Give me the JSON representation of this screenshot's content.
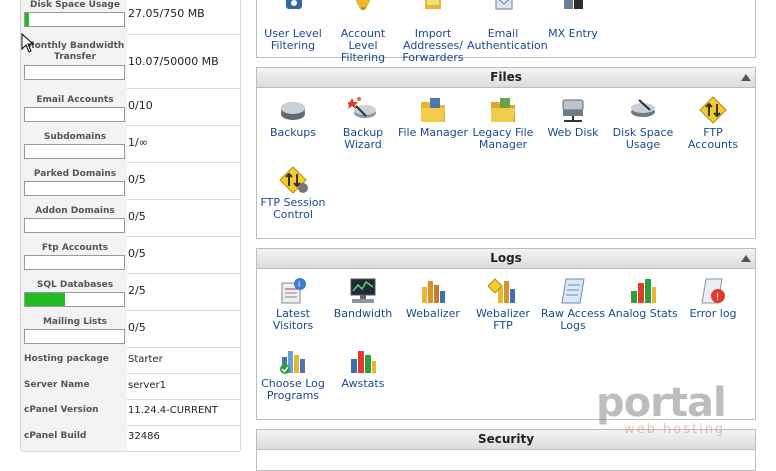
{
  "stats": {
    "disk": {
      "label": "Disk Space Usage",
      "value": "27.05/750 MB",
      "fill": 0.036
    },
    "bandwidth": {
      "label": "Monthly Bandwidth Transfer",
      "value": "10.07/50000 MB",
      "fill": 0.0002
    },
    "email": {
      "label": "Email Accounts",
      "value": "0/10",
      "fill": 0
    },
    "subdomains": {
      "label": "Subdomains",
      "value": "1/∞",
      "fill": 0
    },
    "parked": {
      "label": "Parked Domains",
      "value": "0/5",
      "fill": 0
    },
    "addon": {
      "label": "Addon Domains",
      "value": "0/5",
      "fill": 0
    },
    "ftp": {
      "label": "Ftp Accounts",
      "value": "0/5",
      "fill": 0
    },
    "sql": {
      "label": "SQL Databases",
      "value": "2/5",
      "fill": 0.4
    },
    "mailing": {
      "label": "Mailing Lists",
      "value": "0/5",
      "fill": 0
    },
    "hosting": {
      "label": "Hosting package",
      "value": "Starter"
    },
    "server": {
      "label": "Server Name",
      "value": "server1"
    },
    "cpversion": {
      "label": "cPanel Version",
      "value": "11.24.4-CURRENT"
    },
    "cpbuild": {
      "label": "cPanel Build",
      "value": "32486"
    }
  },
  "mail_panel": {
    "items": [
      {
        "label": "User Level Filtering",
        "icon": "user-filter-icon"
      },
      {
        "label": "Account Level Filtering",
        "icon": "account-filter-icon"
      },
      {
        "label": "Import Addresses/ Forwarders",
        "icon": "import-icon"
      },
      {
        "label": "Email Authentication",
        "icon": "email-auth-icon"
      },
      {
        "label": "MX Entry",
        "icon": "mx-entry-icon"
      }
    ]
  },
  "files": {
    "title": "Files",
    "items": [
      {
        "label": "Backups",
        "icon": "backups-icon"
      },
      {
        "label": "Backup Wizard",
        "icon": "backup-wizard-icon"
      },
      {
        "label": "File Manager",
        "icon": "file-manager-icon"
      },
      {
        "label": "Legacy File Manager",
        "icon": "legacy-file-manager-icon"
      },
      {
        "label": "Web Disk",
        "icon": "web-disk-icon"
      },
      {
        "label": "Disk Space Usage",
        "icon": "disk-usage-icon"
      },
      {
        "label": "FTP Accounts",
        "icon": "ftp-accounts-icon"
      },
      {
        "label": "FTP Session Control",
        "icon": "ftp-session-icon"
      }
    ]
  },
  "logs": {
    "title": "Logs",
    "items": [
      {
        "label": "Latest Visitors",
        "icon": "latest-visitors-icon"
      },
      {
        "label": "Bandwidth",
        "icon": "bandwidth-icon"
      },
      {
        "label": "Webalizer",
        "icon": "webalizer-icon"
      },
      {
        "label": "Webalizer FTP",
        "icon": "webalizer-ftp-icon"
      },
      {
        "label": "Raw Access Logs",
        "icon": "raw-logs-icon"
      },
      {
        "label": "Analog Stats",
        "icon": "analog-stats-icon"
      },
      {
        "label": "Error log",
        "icon": "error-log-icon"
      },
      {
        "label": "Choose Log Programs",
        "icon": "choose-log-icon"
      },
      {
        "label": "Awstats",
        "icon": "awstats-icon"
      }
    ]
  },
  "security": {
    "title": "Security"
  },
  "watermark": {
    "brand": "portal",
    "tagline": "web hosting"
  },
  "colors": {
    "bar_fill": "#22bb22",
    "link": "#1a4a8a",
    "header_bg": "#e6e6e6"
  }
}
